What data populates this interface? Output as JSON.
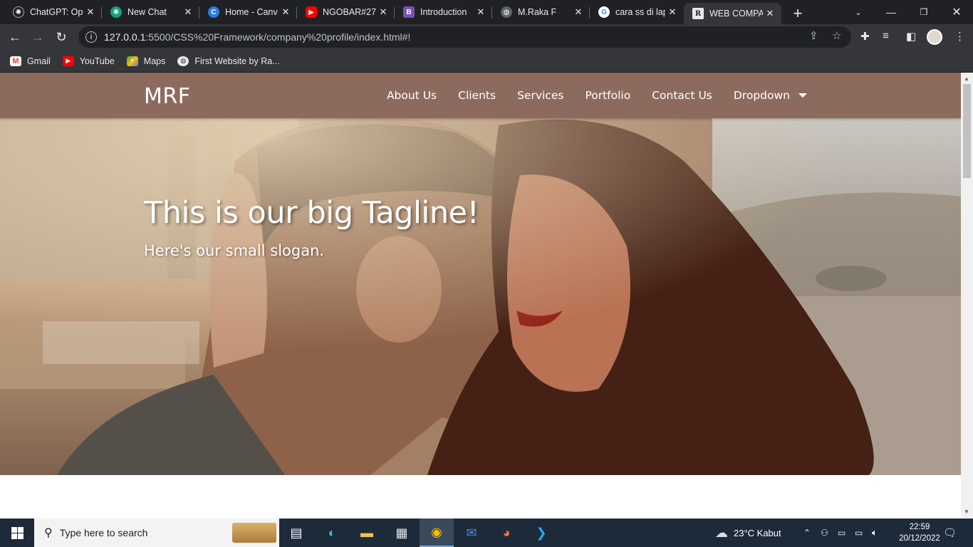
{
  "browser": {
    "tabs": [
      {
        "title": "ChatGPT: Opt",
        "icon": "chatgpt-icon",
        "color": "#202124"
      },
      {
        "title": "New Chat",
        "icon": "chatgpt-icon",
        "color": "#10a37f"
      },
      {
        "title": "Home - Canv",
        "icon": "canva-icon",
        "color": "#2c7be5"
      },
      {
        "title": "NGOBAR#27",
        "icon": "youtube-icon",
        "color": "#ff0000"
      },
      {
        "title": "Introduction",
        "icon": "bootstrap-icon",
        "color": "#7952b3"
      },
      {
        "title": "M.Raka F",
        "icon": "globe-icon",
        "color": "#5f6368"
      },
      {
        "title": "cara ss di lapt",
        "icon": "google-icon",
        "color": "#ffffff"
      },
      {
        "title": "WEB COMPAI",
        "icon": "r-icon",
        "color": "#e8eaed",
        "active": true
      }
    ],
    "url_host": "127.0.0.1",
    "url_rest": ":5500/CSS%20Framework/company%20profile/index.html#!",
    "bookmarks": [
      {
        "label": "Gmail",
        "icon": "gmail-icon",
        "color": "#ea4335"
      },
      {
        "label": "YouTube",
        "icon": "youtube-icon",
        "color": "#ff0000"
      },
      {
        "label": "Maps",
        "icon": "maps-icon",
        "color": "#34a853"
      },
      {
        "label": "First Website by Ra...",
        "icon": "globe-icon",
        "color": "#5f6368"
      }
    ]
  },
  "site": {
    "brand": "MRF",
    "nav": [
      "About Us",
      "Clients",
      "Services",
      "Portfolio",
      "Contact Us",
      "Dropdown"
    ],
    "nav_bg": "#8c6b5e",
    "hero": {
      "tagline": "This is our big Tagline!",
      "slogan": "Here's our small slogan."
    }
  },
  "taskbar": {
    "search_placeholder": "Type here to search",
    "weather": "23°C  Kabut",
    "time": "22:59",
    "date": "20/12/2022"
  }
}
